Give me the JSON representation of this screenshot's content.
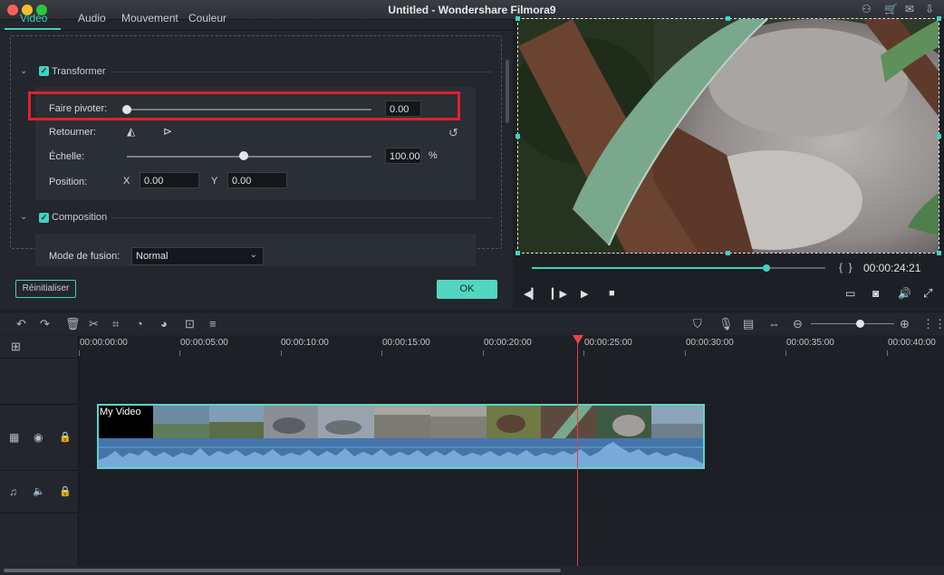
{
  "window": {
    "title": "Untitled - Wondershare Filmora9"
  },
  "tabs": [
    {
      "label": "Vidéo",
      "active": true
    },
    {
      "label": "Audio"
    },
    {
      "label": "Mouvement"
    },
    {
      "label": "Couleur"
    }
  ],
  "transform": {
    "label": "Transformer",
    "enabled": true,
    "rotate": {
      "label": "Faire pivoter:",
      "value": "0.00"
    },
    "flip": {
      "label": "Retourner:"
    },
    "scale": {
      "label": "Échelle:",
      "value": "100.00",
      "unit": "%"
    },
    "position": {
      "label": "Position:",
      "x_label": "X",
      "x_value": "0.00",
      "y_label": "Y",
      "y_value": "0.00"
    }
  },
  "composition": {
    "label": "Composition",
    "enabled": true,
    "blend_mode": {
      "label": "Mode de fusion:",
      "value": "Normal"
    }
  },
  "buttons": {
    "reset": "Réinitialiser",
    "ok": "OK"
  },
  "preview": {
    "timecode": "00:00:24:21",
    "progress_fraction": 0.8
  },
  "timeline": {
    "ruler": [
      "00:00:00:00",
      "00:00:05:00",
      "00:00:10:00",
      "00:00:15:00",
      "00:00:20:00",
      "00:00:25:00",
      "00:00:30:00",
      "00:00:35:00",
      "00:00:40:00"
    ],
    "clip_label": "My Video",
    "zoom_fraction": 0.55
  },
  "colors": {
    "accent": "#3fd3c0",
    "playhead": "#e0404a",
    "highlight": "#e0212b"
  }
}
